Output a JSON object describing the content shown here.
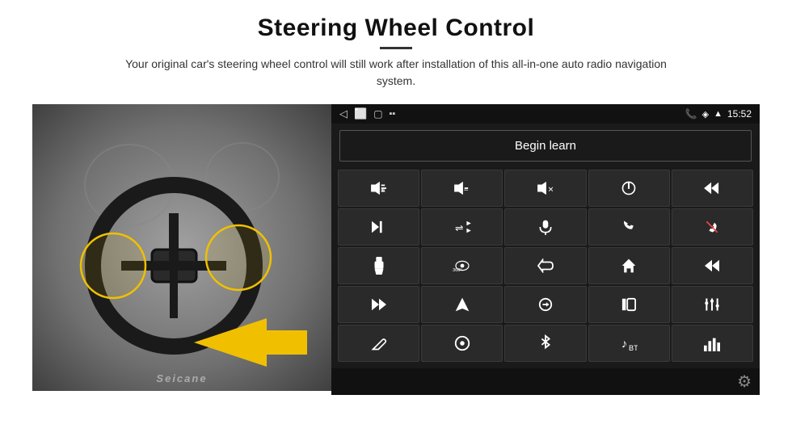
{
  "header": {
    "title": "Steering Wheel Control",
    "subtitle": "Your original car's steering wheel control will still work after installation of this all-in-one auto radio navigation system."
  },
  "status_bar": {
    "time": "15:52",
    "icons_left": [
      "back-arrow",
      "home",
      "square",
      "sim-icon"
    ],
    "icons_right": [
      "phone-icon",
      "wifi-icon",
      "signal-icon",
      "time"
    ]
  },
  "begin_learn_btn": "Begin learn",
  "grid_buttons": [
    {
      "icon": "vol-up",
      "unicode": "🔊+"
    },
    {
      "icon": "vol-down",
      "unicode": "🔉-"
    },
    {
      "icon": "vol-mute",
      "unicode": "🔇"
    },
    {
      "icon": "power",
      "unicode": "⏻"
    },
    {
      "icon": "prev-track",
      "unicode": "⏮"
    },
    {
      "icon": "next-track",
      "unicode": "⏭"
    },
    {
      "icon": "shuffle",
      "unicode": "🔀"
    },
    {
      "icon": "mic",
      "unicode": "🎙"
    },
    {
      "icon": "phone",
      "unicode": "📞"
    },
    {
      "icon": "hang-up",
      "unicode": "📵"
    },
    {
      "icon": "flashlight",
      "unicode": "🔦"
    },
    {
      "icon": "360-view",
      "unicode": "👁"
    },
    {
      "icon": "back",
      "unicode": "↩"
    },
    {
      "icon": "home2",
      "unicode": "⌂"
    },
    {
      "icon": "skip-back",
      "unicode": "⏮"
    },
    {
      "icon": "fast-forward",
      "unicode": "⏭"
    },
    {
      "icon": "navigation",
      "unicode": "➤"
    },
    {
      "icon": "switch",
      "unicode": "⇄"
    },
    {
      "icon": "record",
      "unicode": "⏺"
    },
    {
      "icon": "equalizer",
      "unicode": "🎚"
    },
    {
      "icon": "pen",
      "unicode": "✏"
    },
    {
      "icon": "power2",
      "unicode": "⏺"
    },
    {
      "icon": "bluetooth",
      "unicode": "🔵"
    },
    {
      "icon": "music",
      "unicode": "🎵"
    },
    {
      "icon": "bars",
      "unicode": "📊"
    }
  ],
  "branding": {
    "logo": "Seicane"
  }
}
